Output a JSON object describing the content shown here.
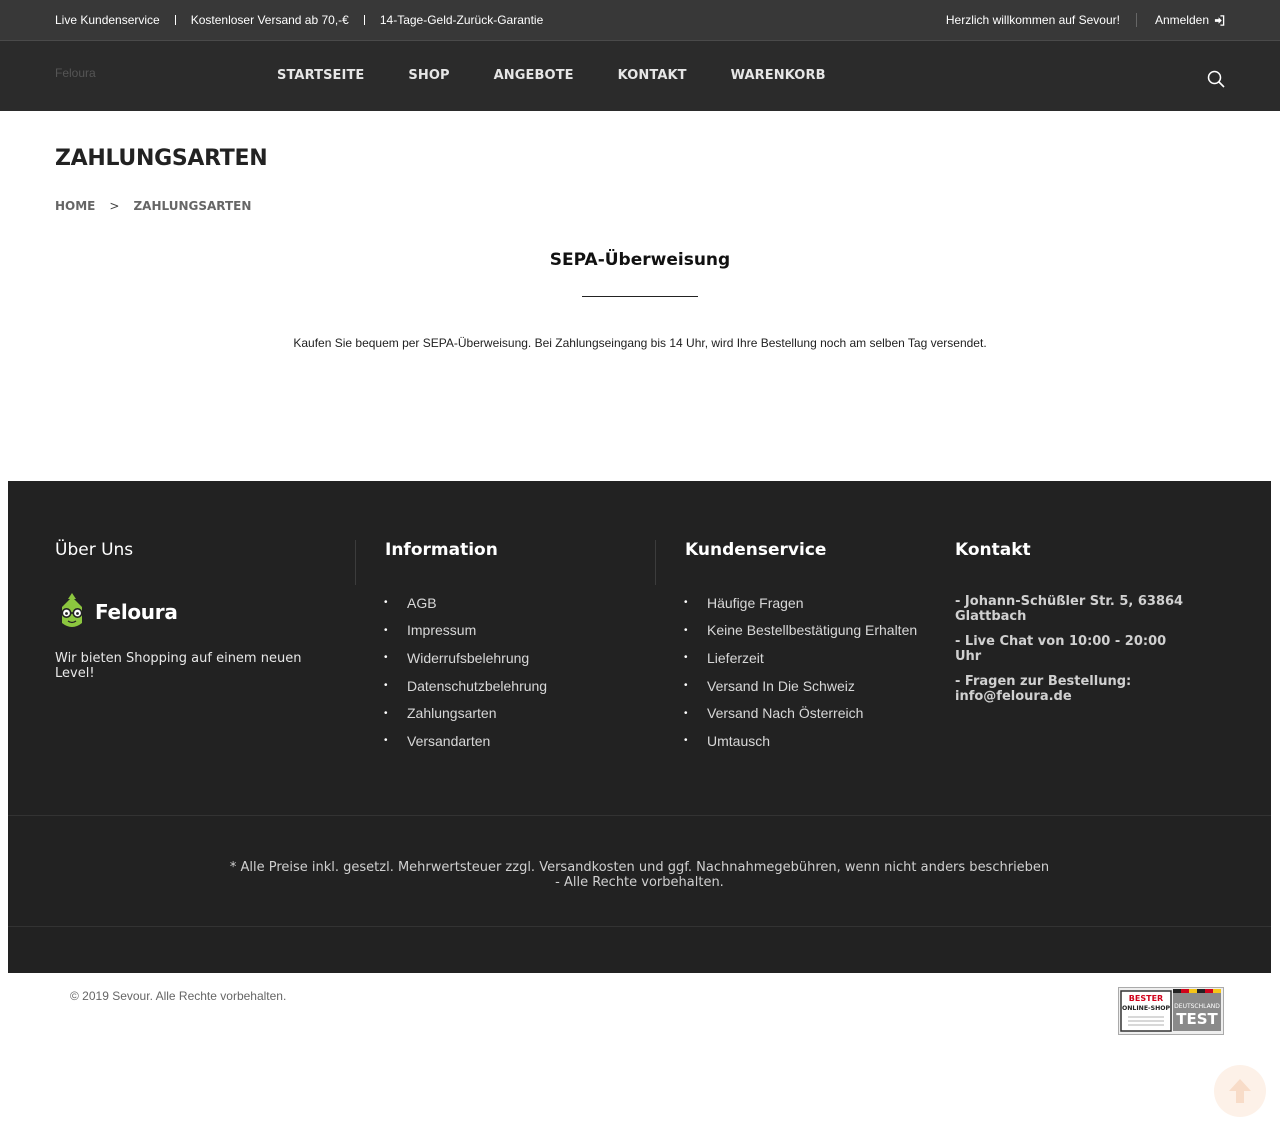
{
  "topbar": {
    "items": [
      "Live Kundenservice",
      "Kostenloser Versand ab 70,-€",
      "14-Tage-Geld-Zurück-Garantie"
    ],
    "welcome": "Herzlich willkommen auf Sevour!",
    "login_label": "Anmelden"
  },
  "header": {
    "logo_text": "Feloura",
    "nav": [
      "STARTSEITE",
      "SHOP",
      "ANGEBOTE",
      "KONTAKT",
      "WARENKORB"
    ]
  },
  "page": {
    "title": "ZAHLUNGSARTEN",
    "breadcrumb": {
      "home": "HOME",
      "separator": ">",
      "current": "ZAHLUNGSARTEN"
    },
    "section_title": "SEPA-Überweisung",
    "section_text": "Kaufen Sie bequem per SEPA-Überweisung. Bei Zahlungseingang bis 14 Uhr, wird Ihre Bestellung noch am selben Tag versendet."
  },
  "footer": {
    "about": {
      "title": "Über Uns",
      "brand_name": "Feloura",
      "text": "Wir bieten Shopping auf einem neuen Level!"
    },
    "information": {
      "title": "Information",
      "items": [
        "AGB",
        "Impressum",
        "Widerrufsbelehrung",
        "Datenschutzbelehrung",
        "Zahlungsarten",
        "Versandarten"
      ]
    },
    "service": {
      "title": "Kundenservice",
      "items": [
        "Häufige Fragen",
        "Keine Bestellbestätigung Erhalten",
        "Lieferzeit",
        "Versand In Die Schweiz",
        "Versand Nach Österreich",
        "Umtausch"
      ]
    },
    "contact": {
      "title": "Kontakt",
      "lines": [
        "- Johann-Schüßler Str. 5, 63864 Glattbach",
        "- Live Chat von 10:00 - 20:00 Uhr",
        "- Fragen zur Bestellung: info@feloura.de"
      ]
    },
    "note_line1": "* Alle Preise inkl. gesetzl. Mehrwertsteuer zzgl. Versandkosten und ggf. Nachnahmegebühren, wenn nicht anders beschrieben",
    "note_line2": "- Alle Rechte vorbehalten."
  },
  "bottom": {
    "copyright": "© 2019 Sevour. Alle Rechte vorbehalten.",
    "badge": {
      "line1": "BESTER",
      "line2": "ONLINE-SHOP",
      "line3": "DEUTSCHLAND",
      "line4": "TEST"
    }
  },
  "colors": {
    "topbar_bg": "#383838",
    "navbar_bg": "#2b2b2b",
    "footer_bg": "#222222",
    "brand_green": "#8cc63f",
    "badge_red": "#d0021b"
  },
  "icons": [
    "login-arrow-icon",
    "search-icon",
    "feloura-logo-icon",
    "arrow-up-icon"
  ]
}
